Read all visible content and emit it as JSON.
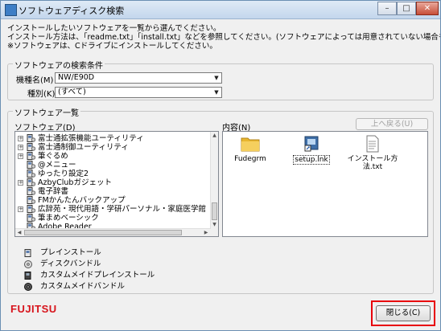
{
  "window": {
    "title": "ソフトウェアディスク検索"
  },
  "title_buttons": {
    "minimize": "–",
    "maximize": "□",
    "close": "✕"
  },
  "intro_lines": [
    "インストールしたいソフトウェアを一覧から選んでください。",
    "インストール方法は、「readme.txt」「install.txt」などを参照してください。(ソフトウェアによっては用意されていない場合もあります)",
    "※ソフトウェアは、Cドライブにインストールしてください。"
  ],
  "search": {
    "legend": "ソフトウェアの検索条件",
    "model_label": "機種名(M)",
    "model_value": "NW/E90D",
    "type_label": "種別(K)",
    "type_value": "(すべて)"
  },
  "software_list": {
    "legend": "ソフトウェア一覧",
    "tree_label": "ソフトウェア(D)",
    "content_label": "内容(N)",
    "back_button": "上へ戻る(U)",
    "tree_items": [
      {
        "label": "富士通拡張機能ユーティリティ",
        "expand": "+"
      },
      {
        "label": "富士通制御ユーティリティ",
        "expand": "+"
      },
      {
        "label": "筆ぐるめ",
        "expand": "+"
      },
      {
        "label": "@メニュー",
        "expand": ""
      },
      {
        "label": "ゆったり設定2",
        "expand": ""
      },
      {
        "label": "AzbyClubガジェット",
        "expand": "+"
      },
      {
        "label": "電子辞書",
        "expand": ""
      },
      {
        "label": "FMかんたんバックアップ",
        "expand": ""
      },
      {
        "label": "広辞苑・現代用語・学研パーソナル・家庭医学館",
        "expand": "+"
      },
      {
        "label": "筆まめベーシック",
        "expand": ""
      },
      {
        "label": "Adobe Reader",
        "expand": ""
      }
    ],
    "content_items": [
      {
        "label": "Fudegrm",
        "icon": "folder-icon"
      },
      {
        "label": "setup.lnk",
        "icon": "setup-shortcut-icon"
      },
      {
        "label": "インストール方法.txt",
        "icon": "text-file-icon"
      }
    ]
  },
  "legend_items": [
    {
      "label": "プレインストール",
      "icon": "preinstall-icon"
    },
    {
      "label": "ディスクバンドル",
      "icon": "disc-bundle-icon"
    },
    {
      "label": "カスタムメイドプレインストール",
      "icon": "custom-preinstall-icon"
    },
    {
      "label": "カスタムメイドバンドル",
      "icon": "custom-bundle-icon"
    }
  ],
  "footer": {
    "logo": "FUJITSU",
    "close_button": "閉じる(C)"
  },
  "colors": {
    "highlight": "#e8000b",
    "brand": "#d7131b",
    "folder": "#e8b630"
  }
}
